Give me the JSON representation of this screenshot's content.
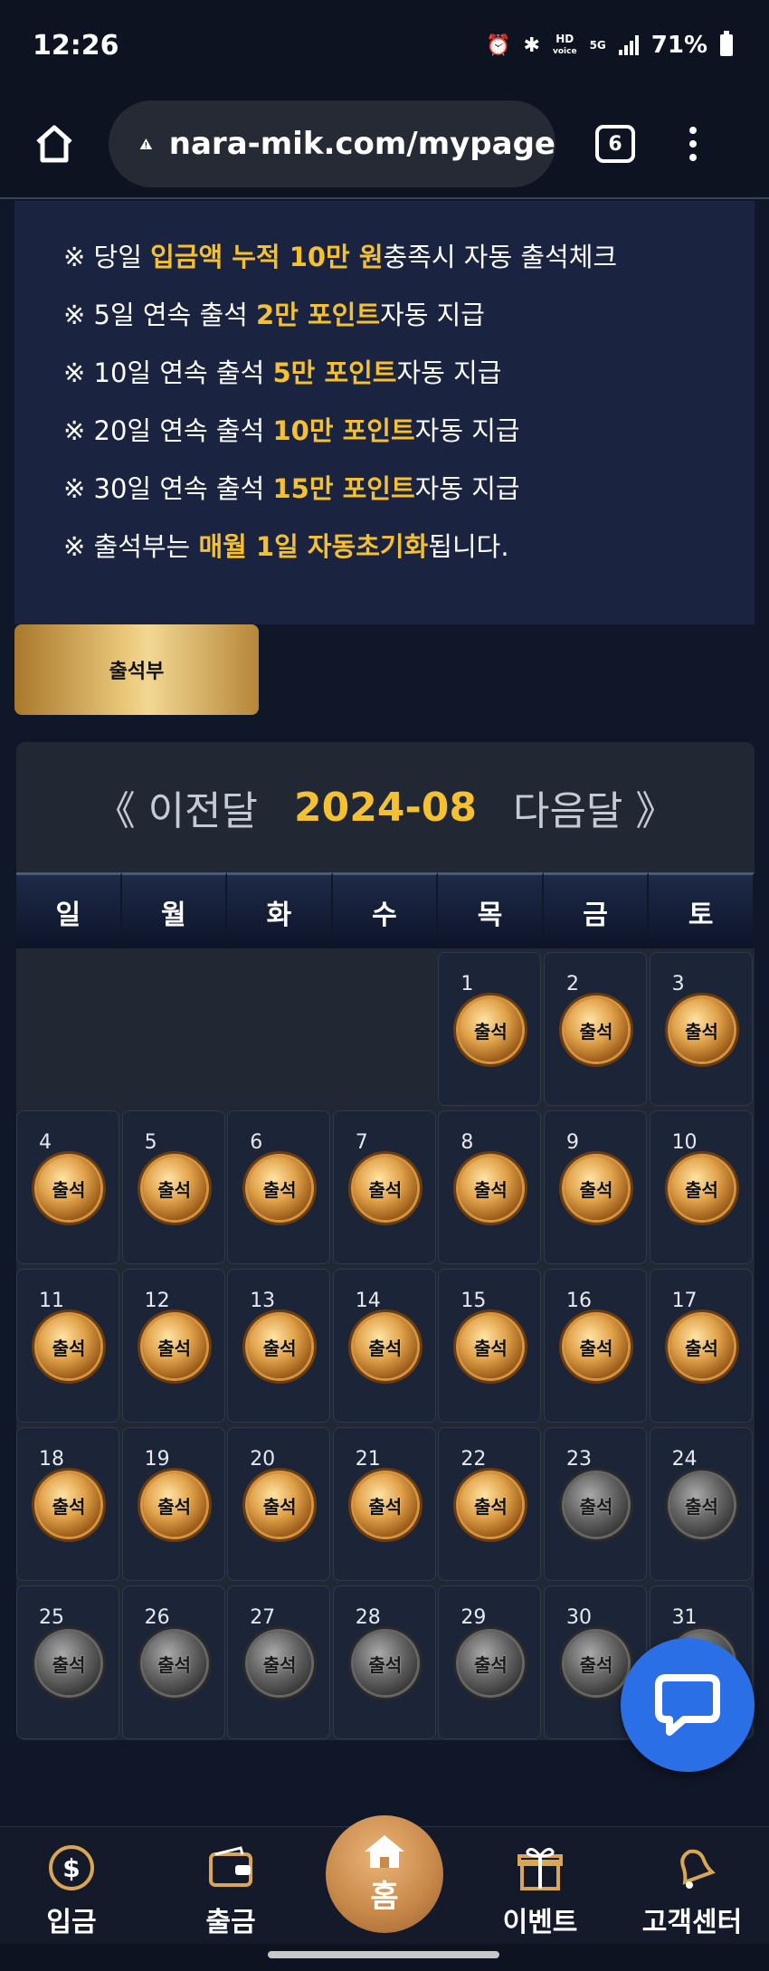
{
  "status_bar": {
    "time": "12:26",
    "hd_label": "HD",
    "voice_label": "voice",
    "net_label": "5G",
    "battery": "71%"
  },
  "browser": {
    "url": "nara-mik.com/mypage",
    "tab_count": "6"
  },
  "notice": {
    "lines": [
      {
        "prefix": "※ 당일 ",
        "highlight": "입금액 누적 10만 원",
        "suffix": "충족시 자동 출석체크"
      },
      {
        "prefix": "※ 5일 연속 출석 ",
        "highlight": "2만 포인트",
        "suffix": "자동 지급"
      },
      {
        "prefix": "※ 10일 연속 출석 ",
        "highlight": "5만 포인트",
        "suffix": "자동 지급"
      },
      {
        "prefix": "※ 20일 연속 출석 ",
        "highlight": "10만 포인트",
        "suffix": "자동 지급"
      },
      {
        "prefix": "※ 30일 연속 출석 ",
        "highlight": "15만 포인트",
        "suffix": "자동 지급"
      },
      {
        "prefix": "※ 출석부는 ",
        "highlight": "매월 1일 자동초기화",
        "suffix": "됩니다."
      }
    ]
  },
  "attendance_button": "출석부",
  "calendar": {
    "prev_label": "《 이전달",
    "month": "2024-08",
    "next_label": "다음달 》",
    "weekdays": [
      "일",
      "월",
      "화",
      "수",
      "목",
      "금",
      "토"
    ],
    "stamp_label": "출석",
    "leading_blanks": 4,
    "days": [
      {
        "n": "1",
        "attended": true
      },
      {
        "n": "2",
        "attended": true
      },
      {
        "n": "3",
        "attended": true
      },
      {
        "n": "4",
        "attended": true
      },
      {
        "n": "5",
        "attended": true
      },
      {
        "n": "6",
        "attended": true
      },
      {
        "n": "7",
        "attended": true
      },
      {
        "n": "8",
        "attended": true
      },
      {
        "n": "9",
        "attended": true
      },
      {
        "n": "10",
        "attended": true
      },
      {
        "n": "11",
        "attended": true
      },
      {
        "n": "12",
        "attended": true
      },
      {
        "n": "13",
        "attended": true
      },
      {
        "n": "14",
        "attended": true
      },
      {
        "n": "15",
        "attended": true
      },
      {
        "n": "16",
        "attended": true
      },
      {
        "n": "17",
        "attended": true
      },
      {
        "n": "18",
        "attended": true
      },
      {
        "n": "19",
        "attended": true
      },
      {
        "n": "20",
        "attended": true
      },
      {
        "n": "21",
        "attended": true
      },
      {
        "n": "22",
        "attended": true
      },
      {
        "n": "23",
        "attended": false
      },
      {
        "n": "24",
        "attended": false
      },
      {
        "n": "25",
        "attended": false
      },
      {
        "n": "26",
        "attended": false
      },
      {
        "n": "27",
        "attended": false
      },
      {
        "n": "28",
        "attended": false
      },
      {
        "n": "29",
        "attended": false
      },
      {
        "n": "30",
        "attended": false
      },
      {
        "n": "31",
        "attended": false
      }
    ]
  },
  "bottom_nav": {
    "deposit": "입금",
    "withdraw": "출금",
    "home": "홈",
    "event": "이벤트",
    "support": "고객센터"
  },
  "colors": {
    "highlight": "#f5c12e",
    "chat_button": "#2b6fe6"
  }
}
